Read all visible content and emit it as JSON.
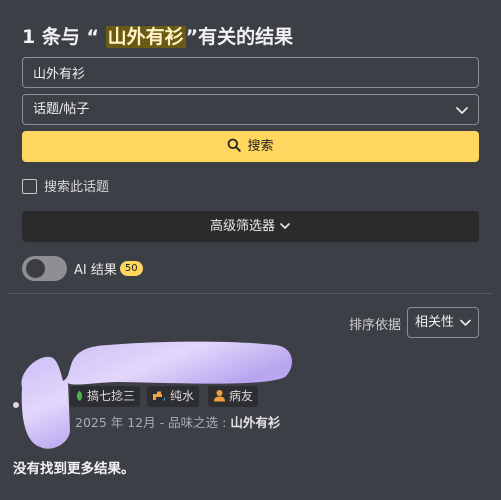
{
  "header": {
    "title_prefix": "1 条与 “ ",
    "title_query": "山外有衫",
    "title_suffix": "”有关的结果"
  },
  "search": {
    "value": "山外有衫",
    "scope_selected": "话题/帖子",
    "button_label": "搜索"
  },
  "filters": {
    "search_this_topic_label": "搜索此话题",
    "search_this_topic_checked": false,
    "advanced_label": "高级筛选器"
  },
  "ai": {
    "label": "AI 结果",
    "count": "50",
    "enabled": false
  },
  "sort": {
    "label": "排序依据",
    "selected": "相关性"
  },
  "result": {
    "tags": [
      {
        "label": "搞七捻三",
        "icon": "leaf-icon"
      },
      {
        "label": "纯水",
        "icon": "water-tap-icon"
      },
      {
        "label": "病友",
        "icon": "person-icon"
      }
    ],
    "date": "2025 年 12月",
    "separator": " - ",
    "tag_prefix": "品味之选 : ",
    "tag_highlight": "山外有衫"
  },
  "footer": {
    "no_more_results": "没有找到更多结果。"
  },
  "colors": {
    "background": "#3c3f45",
    "accent": "#ffd75e",
    "highlight_bg": "#6b5a13"
  }
}
